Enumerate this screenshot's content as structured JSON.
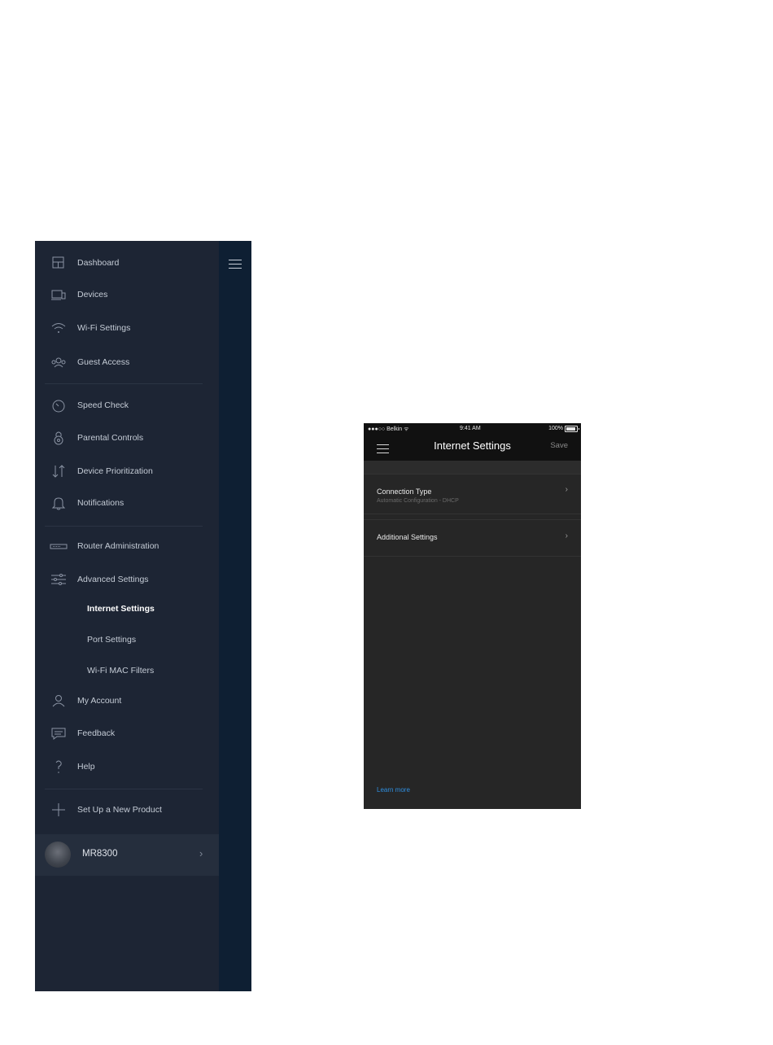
{
  "sidebar": {
    "items": [
      {
        "label": "Dashboard",
        "icon": "dashboard-icon"
      },
      {
        "label": "Devices",
        "icon": "devices-icon"
      },
      {
        "label": "Wi-Fi Settings",
        "icon": "wifi-icon"
      },
      {
        "label": "Guest Access",
        "icon": "guest-access-icon"
      },
      {
        "label": "Speed Check",
        "icon": "speed-check-icon"
      },
      {
        "label": "Parental Controls",
        "icon": "parental-controls-icon"
      },
      {
        "label": "Device Prioritization",
        "icon": "prioritization-icon"
      },
      {
        "label": "Notifications",
        "icon": "bell-icon"
      },
      {
        "label": "Router Administration",
        "icon": "router-icon"
      },
      {
        "label": "Advanced Settings",
        "icon": "sliders-icon"
      },
      {
        "label": "My Account",
        "icon": "user-icon"
      },
      {
        "label": "Feedback",
        "icon": "feedback-icon"
      },
      {
        "label": "Help",
        "icon": "help-icon"
      },
      {
        "label": "Set Up a New Product",
        "icon": "plus-icon"
      }
    ],
    "advanced_subitems": [
      {
        "label": "Internet Settings",
        "active": true
      },
      {
        "label": "Port Settings",
        "active": false
      },
      {
        "label": "Wi-Fi MAC Filters",
        "active": false
      }
    ],
    "product": {
      "name": "MR8300",
      "chevron": "›"
    }
  },
  "phone": {
    "status": {
      "carrier": "●●●○○ Belkin ᯤ",
      "time": "9:41 AM",
      "battery": "100%"
    },
    "title": "Internet Settings",
    "save_label": "Save",
    "rows": [
      {
        "title": "Connection Type",
        "subtitle": "Automatic Configuration - DHCP",
        "chevron": "›"
      },
      {
        "title": "Additional Settings",
        "chevron": "›"
      }
    ],
    "learn_more": "Learn more"
  },
  "colors": {
    "menu_bg": "#1d2534",
    "drawer_edge": "#0e1f33",
    "phone_bg": "#262626",
    "link": "#2f8fe0"
  }
}
